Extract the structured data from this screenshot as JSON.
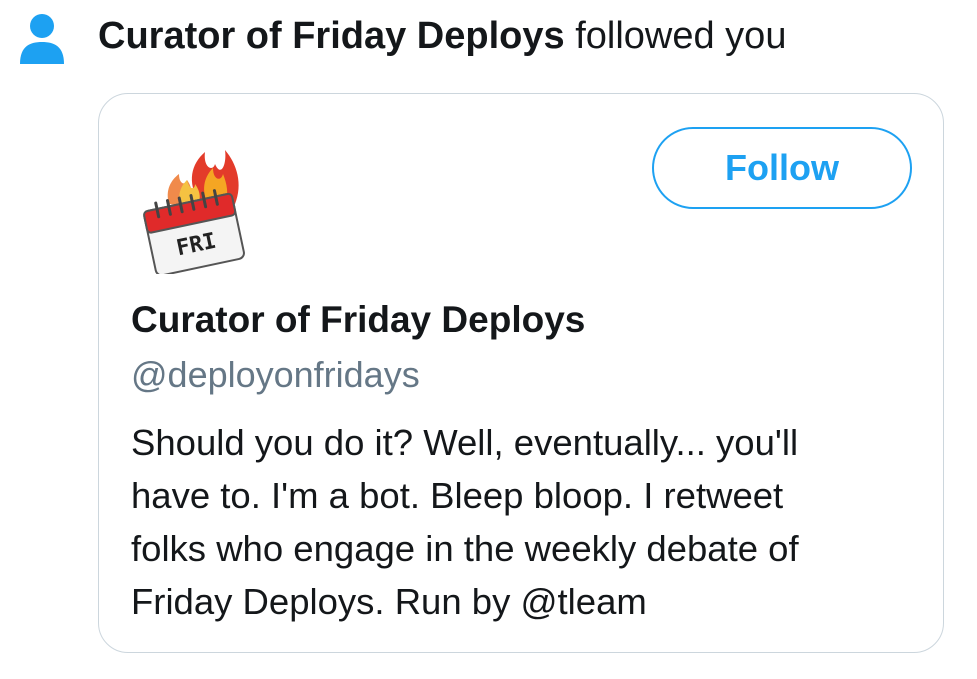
{
  "notification": {
    "name": "Curator of Friday Deploys",
    "action": "followed you",
    "icon": "person-icon"
  },
  "card": {
    "avatar_icon": "fire-calendar-avatar",
    "avatar_text": "FRI",
    "follow_label": "Follow",
    "display_name": "Curator of Friday Deploys",
    "handle": "@deployonfridays",
    "bio_lines": [
      "Should you do it? Well, eventually... you'll",
      "have to. I'm a bot. Bleep bloop. I retweet",
      "folks who engage in the weekly debate of",
      "Friday Deploys. Run by @tleam"
    ]
  },
  "colors": {
    "accent": "#1da1f2",
    "secondary_text": "#657786",
    "border": "#ccd6dd"
  }
}
